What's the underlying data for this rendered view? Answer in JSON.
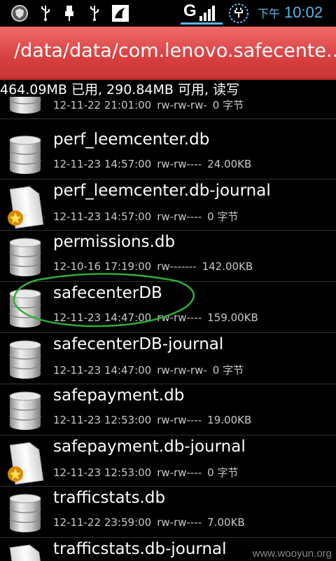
{
  "status_bar": {
    "network": "G",
    "ampm": "下午",
    "time": "10:02",
    "time_color": "#5ab4e8"
  },
  "title_bar": {
    "path": "/data/data/com.lenovo.safecente...",
    "color": "#d84040"
  },
  "storage_info": "464.09MB 已用, 290.84MB 可用, 读写",
  "files": [
    {
      "name": "",
      "date": "12-11-22 21:01:00",
      "perms": "rw-rw-rw-",
      "size": "0 字节",
      "icon": "database-icon"
    },
    {
      "name": "perf_leemcenter.db",
      "date": "12-11-23 14:57:00",
      "perms": "rw-rw----",
      "size": "24.00KB",
      "icon": "database-icon"
    },
    {
      "name": "perf_leemcenter.db-journal",
      "date": "12-11-23 14:57:00",
      "perms": "rw-rw----",
      "size": "0 字节",
      "icon": "file-badge-icon"
    },
    {
      "name": "permissions.db",
      "date": "12-10-16 17:19:00",
      "perms": "rw-------",
      "size": "142.00KB",
      "icon": "database-icon"
    },
    {
      "name": "safecenterDB",
      "date": "12-11-23 14:47:00",
      "perms": "rw-rw----",
      "size": "159.00KB",
      "icon": "database-icon",
      "circled": true
    },
    {
      "name": "safecenterDB-journal",
      "date": "12-11-23 14:47:00",
      "perms": "rw-rw-rw-",
      "size": "0 字节",
      "icon": "database-icon"
    },
    {
      "name": "safepayment.db",
      "date": "12-11-23 12:53:00",
      "perms": "rw-rw----",
      "size": "19.00KB",
      "icon": "database-icon"
    },
    {
      "name": "safepayment.db-journal",
      "date": "12-11-23 12:53:00",
      "perms": "rw-rw----",
      "size": "0 字节",
      "icon": "file-badge-icon"
    },
    {
      "name": "trafficstats.db",
      "date": "12-11-22 23:59:00",
      "perms": "rw-rw----",
      "size": "7.00KB",
      "icon": "database-icon"
    },
    {
      "name": "trafficstats.db-journal",
      "date": "",
      "perms": "",
      "size": "",
      "icon": "file-badge-icon"
    }
  ],
  "watermark": "www.wooyun.org"
}
